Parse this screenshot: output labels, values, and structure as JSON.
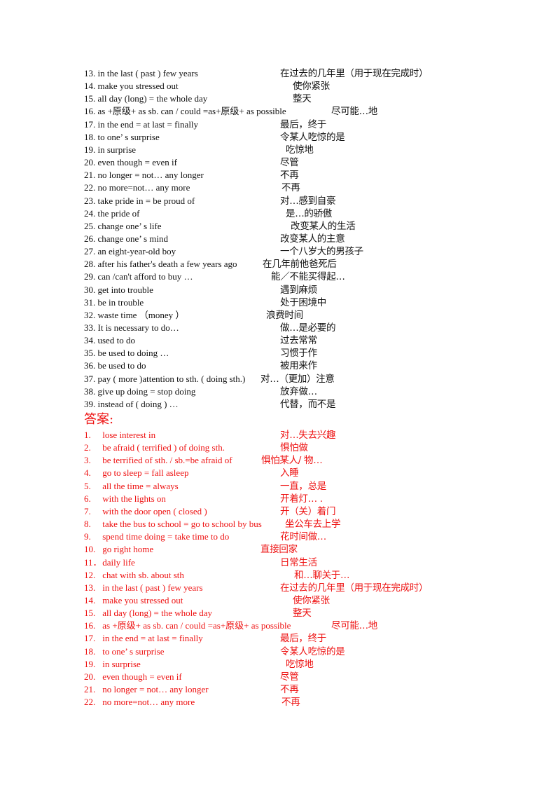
{
  "colors": {
    "text": "#111111",
    "answer": "#ee1111"
  },
  "questions": [
    {
      "n": "13.",
      "en": "in the last ( past ) few years",
      "zh": "在过去的几年里（用于现在完成时）",
      "zx": 400
    },
    {
      "n": "14.",
      "en": "make you stressed out",
      "zh": "使你紧张",
      "zx": 418
    },
    {
      "n": "15.",
      "en": "all day (long) = the whole day",
      "zh": "整天",
      "zx": 418
    },
    {
      "n": "16.",
      "en": "as +原级+ as sb. can / could =as+原级+ as possible",
      "zh": "尽可能…地",
      "zx": 473
    },
    {
      "n": "17.",
      "en": "in the end = at last = finally",
      "zh": "最后，终于",
      "zx": 400
    },
    {
      "n": "18.",
      "en": "to one’ s surprise",
      "zh": "令某人吃惊的是",
      "zx": 400
    },
    {
      "n": "19.",
      "en": "in surprise",
      "zh": "吃惊地",
      "zx": 408
    },
    {
      "n": "20.",
      "en": "even though = even if",
      "zh": "尽管",
      "zx": 400
    },
    {
      "n": "21.",
      "en": "no longer = not…  any longer",
      "zh": "不再",
      "zx": 400
    },
    {
      "n": "22.",
      "en": "no more=not…  any more",
      "zh": "不再",
      "zx": 402
    },
    {
      "n": "23.",
      "en": "take pride in = be proud of",
      "zh": "对…感到自豪",
      "zx": 400
    },
    {
      "n": "24.",
      "en": "the pride of",
      "zh": "是…的骄傲",
      "zx": 408
    },
    {
      "n": "25.",
      "en": "change one’ s life",
      "zh": "改变某人的生活",
      "zx": 415
    },
    {
      "n": "26.",
      "en": "change one’ s mind",
      "zh": "改变某人的主意",
      "zx": 400
    },
    {
      "n": "27.",
      "en": "an eight-year-old boy",
      "zh": "一个八岁大的男孩子",
      "zx": 400
    },
    {
      "n": "28.",
      "en": "after his father's death a few years ago",
      "zh": "在几年前他爸死后",
      "zx": 375
    },
    {
      "n": "29.",
      "en": "can /can't    afford to buy  …",
      "zh": "能／不能买得起…",
      "zx": 387
    },
    {
      "n": "30.",
      "en": "get into trouble",
      "zh": "遇到麻烦",
      "zx": 400
    },
    {
      "n": "31.",
      "en": "be in trouble",
      "zh": "处于困境中",
      "zx": 400
    },
    {
      "n": "32.",
      "en": "waste time  （money  ）",
      "zh": "浪费时间",
      "zx": 380
    },
    {
      "n": "33.",
      "en": "It is necessary to do…",
      "zh": "做…是必要的",
      "zx": 400
    },
    {
      "n": "34.",
      "en": "used to do",
      "zh": "过去常常",
      "zx": 400
    },
    {
      "n": "35.",
      "en": "be used to doing  …",
      "zh": "习惯于作",
      "zx": 400
    },
    {
      "n": "36.",
      "en": "be used to do",
      "zh": "被用来作",
      "zx": 400
    },
    {
      "n": "37.",
      "en": "pay ( more )attention to sth. ( doing sth.)",
      "zh": "对…（更加）注意",
      "zx": 372
    },
    {
      "n": "38.",
      "en": "give up doing = stop doing",
      "zh": "放弃做…",
      "zx": 400
    },
    {
      "n": "39.",
      "en": "instead of ( doing )  …",
      "zh": "代替，而不是",
      "zx": 400
    }
  ],
  "answers_heading": "答案:",
  "answers": [
    {
      "n": "1.",
      "en": "lose interest in",
      "zh": "对…失去兴趣",
      "zx": 400
    },
    {
      "n": "2.",
      "en": "be afraid ( terrified ) of doing sth.",
      "zh": "惧怕做",
      "zx": 400
    },
    {
      "n": "3.",
      "en": "be terrified of sth. / sb.=be afraid of",
      "zh": "惧怕某人/  物…",
      "zx": 373
    },
    {
      "n": "4.",
      "en": "go to sleep = fall asleep",
      "zh": "入睡",
      "zx": 400
    },
    {
      "n": "5.",
      "en": "all the time = always",
      "zh": "一直，总是",
      "zx": 400
    },
    {
      "n": "6.",
      "en": "with the lights on",
      "zh": "开着灯… .",
      "zx": 400
    },
    {
      "n": "7.",
      "en": "with the door open ( closed )",
      "zh": "开（关）着门",
      "zx": 400
    },
    {
      "n": "8.",
      "en": "take the bus to school = go to school by bus",
      "zh": "坐公车去上学",
      "zx": 407
    },
    {
      "n": "9.",
      "en": "spend time doing = take time to do",
      "zh": "花时间做…",
      "zx": 400
    },
    {
      "n": "10.",
      "en": "go right home",
      "zh": "直接回家",
      "zx": 372
    },
    {
      "n": "11．",
      "en": "daily life",
      "zh": "日常生活",
      "zx": 400
    },
    {
      "n": "12.",
      "en": "chat with sb. about sth",
      "zh": "和…聊关于…",
      "zx": 420
    },
    {
      "n": "13.",
      "en": "in the last ( past ) few years",
      "zh": "在过去的几年里（用于现在完成时）",
      "zx": 400
    },
    {
      "n": "14.",
      "en": "make you stressed out",
      "zh": "使你紧张",
      "zx": 418
    },
    {
      "n": "15.",
      "en": "all day (long) = the whole day",
      "zh": "整天",
      "zx": 418
    },
    {
      "n": "16.",
      "en": "as +原级+ as sb. can / could =as+原级+ as possible",
      "zh": "尽可能…地",
      "zx": 473
    },
    {
      "n": "17.",
      "en": "in the end = at last = finally",
      "zh": "最后，终于",
      "zx": 400
    },
    {
      "n": "18.",
      "en": "to one’ s surprise",
      "zh": "令某人吃惊的是",
      "zx": 400
    },
    {
      "n": "19.",
      "en": "in surprise",
      "zh": "吃惊地",
      "zx": 408
    },
    {
      "n": "20.",
      "en": "even though = even if",
      "zh": "尽管",
      "zx": 400
    },
    {
      "n": "21.",
      "en": "no longer = not…  any longer",
      "zh": "不再",
      "zx": 400
    },
    {
      "n": "22.",
      "en": "no more=not…  any more",
      "zh": "不再",
      "zx": 402
    }
  ]
}
